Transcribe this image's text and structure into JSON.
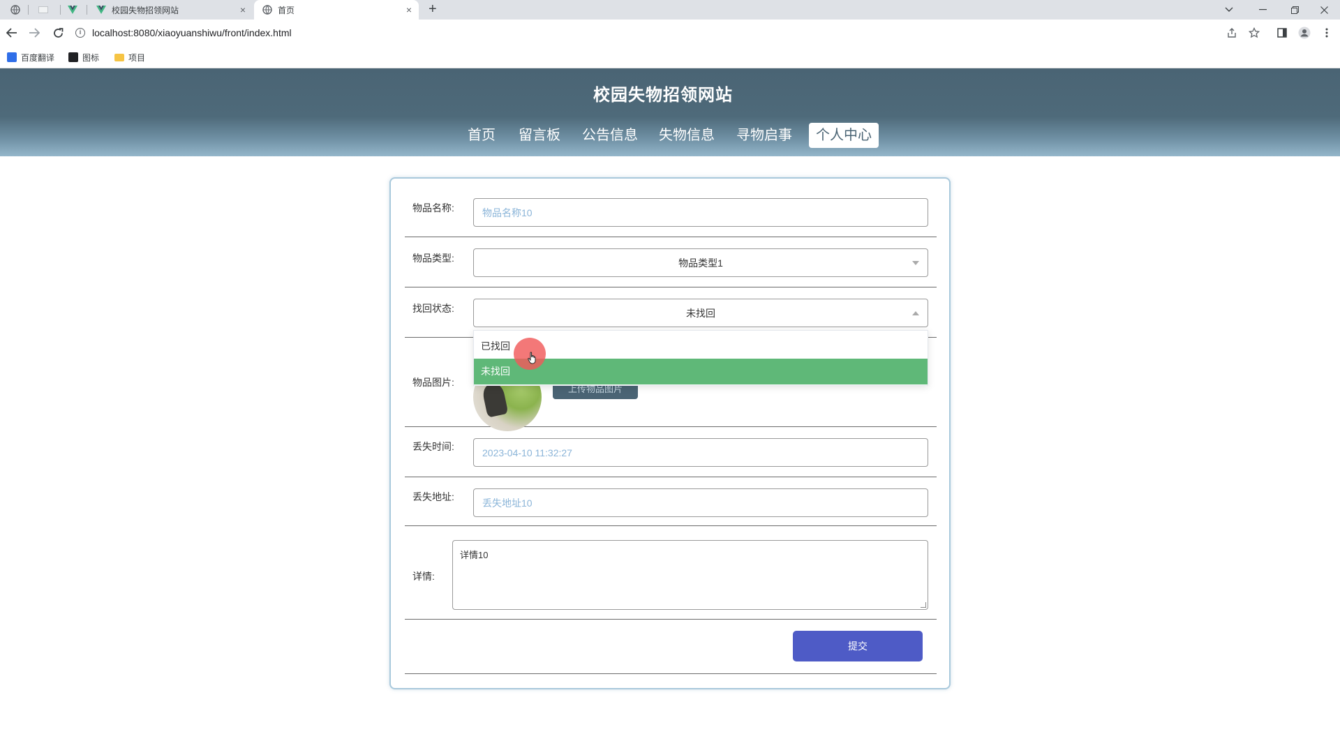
{
  "browser": {
    "tabs": [
      {
        "title": "校园失物招领网站",
        "active": false
      },
      {
        "title": "首页",
        "active": true
      }
    ],
    "url": "localhost:8080/xiaoyuanshiwu/front/index.html",
    "bookmarks": [
      "百度翻译",
      "图标",
      "项目"
    ],
    "icons": {
      "back": "arrow-left",
      "forward": "arrow-right",
      "reload": "reload",
      "share": "share",
      "star": "star",
      "sidepanel": "side-panel",
      "profile": "profile",
      "menu": "kebab-menu",
      "new_tab": "+",
      "close": "×"
    },
    "close_glyph": "×"
  },
  "site": {
    "title": "校园失物招领网站",
    "nav": [
      "首页",
      "留言板",
      "公告信息",
      "失物信息",
      "寻物启事",
      "个人中心"
    ],
    "active_nav": "个人中心"
  },
  "form": {
    "name": {
      "label": "物品名称:",
      "value": "物品名称10"
    },
    "type": {
      "label": "物品类型:",
      "value": "物品类型1"
    },
    "status": {
      "label": "找回状态:",
      "value": "未找回",
      "options": [
        "已找回",
        "未找回"
      ],
      "highlighted": "未找回"
    },
    "image": {
      "label": "物品图片:",
      "upload_label": "上传物品图片"
    },
    "lost_time": {
      "label": "丢失时间:",
      "value": "2023-04-10 11:32:27"
    },
    "lost_address": {
      "label": "丢失地址:",
      "value": "丢失地址10"
    },
    "details": {
      "label": "详情:",
      "value": "详情10"
    },
    "submit_label": "提交"
  },
  "colors": {
    "header": "#4a6474",
    "submit": "#4e5bc6",
    "option_selected": "#5fb878",
    "placeholder_text": "#8ab4d8"
  }
}
